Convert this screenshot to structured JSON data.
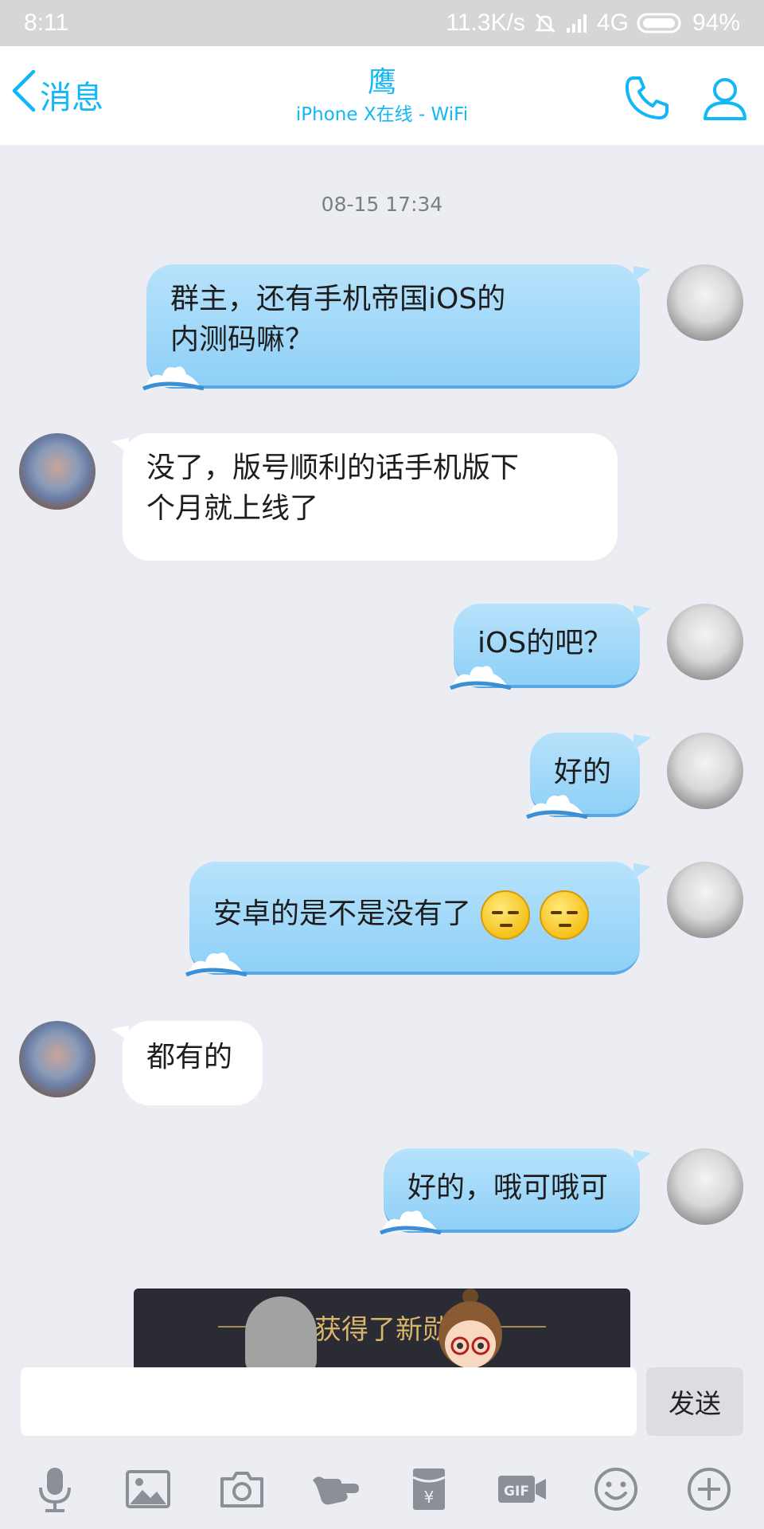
{
  "status_bar": {
    "time": "8:11",
    "net_speed": "11.3K/s",
    "network": "4G",
    "battery": "94%"
  },
  "header": {
    "back_label": "消息",
    "title": "鹰",
    "subtitle": "iPhone X在线 - WiFi"
  },
  "chat": {
    "timestamp": "08-15 17:34",
    "messages": [
      {
        "sender": "me",
        "line1": "群主，还有手机帝国iOS的",
        "line2": "内测码嘛？"
      },
      {
        "sender": "them",
        "line1": "没了，版号顺利的话手机版下",
        "line2": "个月就上线了"
      },
      {
        "sender": "me",
        "text": "iOS的吧？"
      },
      {
        "sender": "me",
        "text": "好的"
      },
      {
        "sender": "me",
        "text": "安卓的是不是没有了"
      },
      {
        "sender": "them",
        "text": "都有的"
      },
      {
        "sender": "me",
        "text": "好的，哦可哦可"
      }
    ]
  },
  "banner": {
    "text": "获得了新勋"
  },
  "input": {
    "send_label": "发送",
    "value": ""
  },
  "toolbar": {
    "items": [
      "microphone-icon",
      "image-icon",
      "camera-icon",
      "poke-icon",
      "red-packet-icon",
      "gif-icon",
      "emoji-icon",
      "plus-icon"
    ]
  },
  "colors": {
    "accent": "#12b7f5",
    "my_bubble": "#a6daf9",
    "their_bubble": "#ffffff",
    "background": "#ebedf2"
  }
}
